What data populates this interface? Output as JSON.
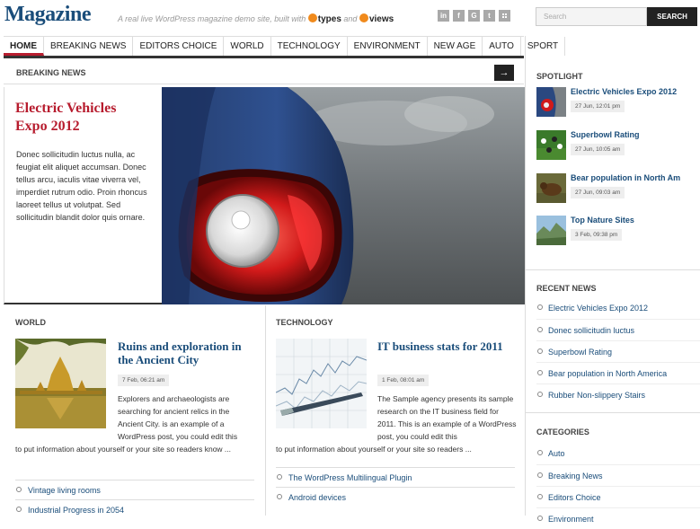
{
  "header": {
    "logo": "Magazine",
    "tagline": "A real live WordPress magazine demo site, built with",
    "brand1": "types",
    "tagline_and": "and",
    "brand2": "views",
    "social": [
      "in",
      "f",
      "G",
      "t",
      "rss"
    ],
    "search_placeholder": "Search",
    "search_button": "SEARCH"
  },
  "nav": [
    "HOME",
    "BREAKING NEWS",
    "EDITORS CHOICE",
    "WORLD",
    "TECHNOLOGY",
    "ENVIRONMENT",
    "NEW AGE",
    "AUTO",
    "SPORT"
  ],
  "breaking": {
    "heading": "BREAKING NEWS",
    "arrow": "→",
    "title": "Electric Vehicles Expo 2012",
    "text": "Donec sollicitudin luctus nulla, ac feugiat elit aliquet accumsan. Donec tellus arcu, iaculis vitae viverra vel, imperdiet rutrum odio. Proin rhoncus laoreet tellus ut volutpat. Sed sollicitudin blandit dolor quis ornare."
  },
  "world": {
    "heading": "WORLD",
    "title": "Ruins and exploration in the Ancient City",
    "date": "7 Feb, 06:21 am",
    "text_top": "Explorers and archaeologists are searching for ancient relics in the Ancient City. is an example of a WordPress post, you could edit this",
    "text_bottom": "to put information about yourself or your site so readers know ...",
    "links": [
      "Vintage living rooms",
      "Industrial Progress in 2054"
    ]
  },
  "technology": {
    "heading": "TECHNOLOGY",
    "title": "IT business stats for 2011",
    "date": "1 Feb, 08:01 am",
    "text_top": "The Sample agency presents its sample research on the IT business field for 2011. This is an example of a WordPress post, you could edit this",
    "text_bottom": "to put information about yourself or your site so readers ...",
    "links": [
      "The WordPress Multilingual Plugin",
      "Android devices"
    ]
  },
  "sidebar": {
    "spotlight_heading": "SPOTLIGHT",
    "spotlight": [
      {
        "title": "Electric Vehicles Expo 2012",
        "date": "27 Jun, 12:01 pm"
      },
      {
        "title": "Superbowl Rating",
        "date": "27 Jun, 10:05 am"
      },
      {
        "title": "Bear population in North Am",
        "date": "27 Jun, 09:03 am"
      },
      {
        "title": "Top Nature Sites",
        "date": "3 Feb, 09:38 pm"
      }
    ],
    "recent_heading": "RECENT NEWS",
    "recent": [
      "Electric Vehicles Expo 2012",
      "Donec sollicitudin luctus",
      "Superbowl Rating",
      "Bear population in North America",
      "Rubber Non-slippery Stairs"
    ],
    "categories_heading": "CATEGORIES",
    "categories": [
      "Auto",
      "Breaking News",
      "Editors Choice",
      "Environment"
    ]
  }
}
